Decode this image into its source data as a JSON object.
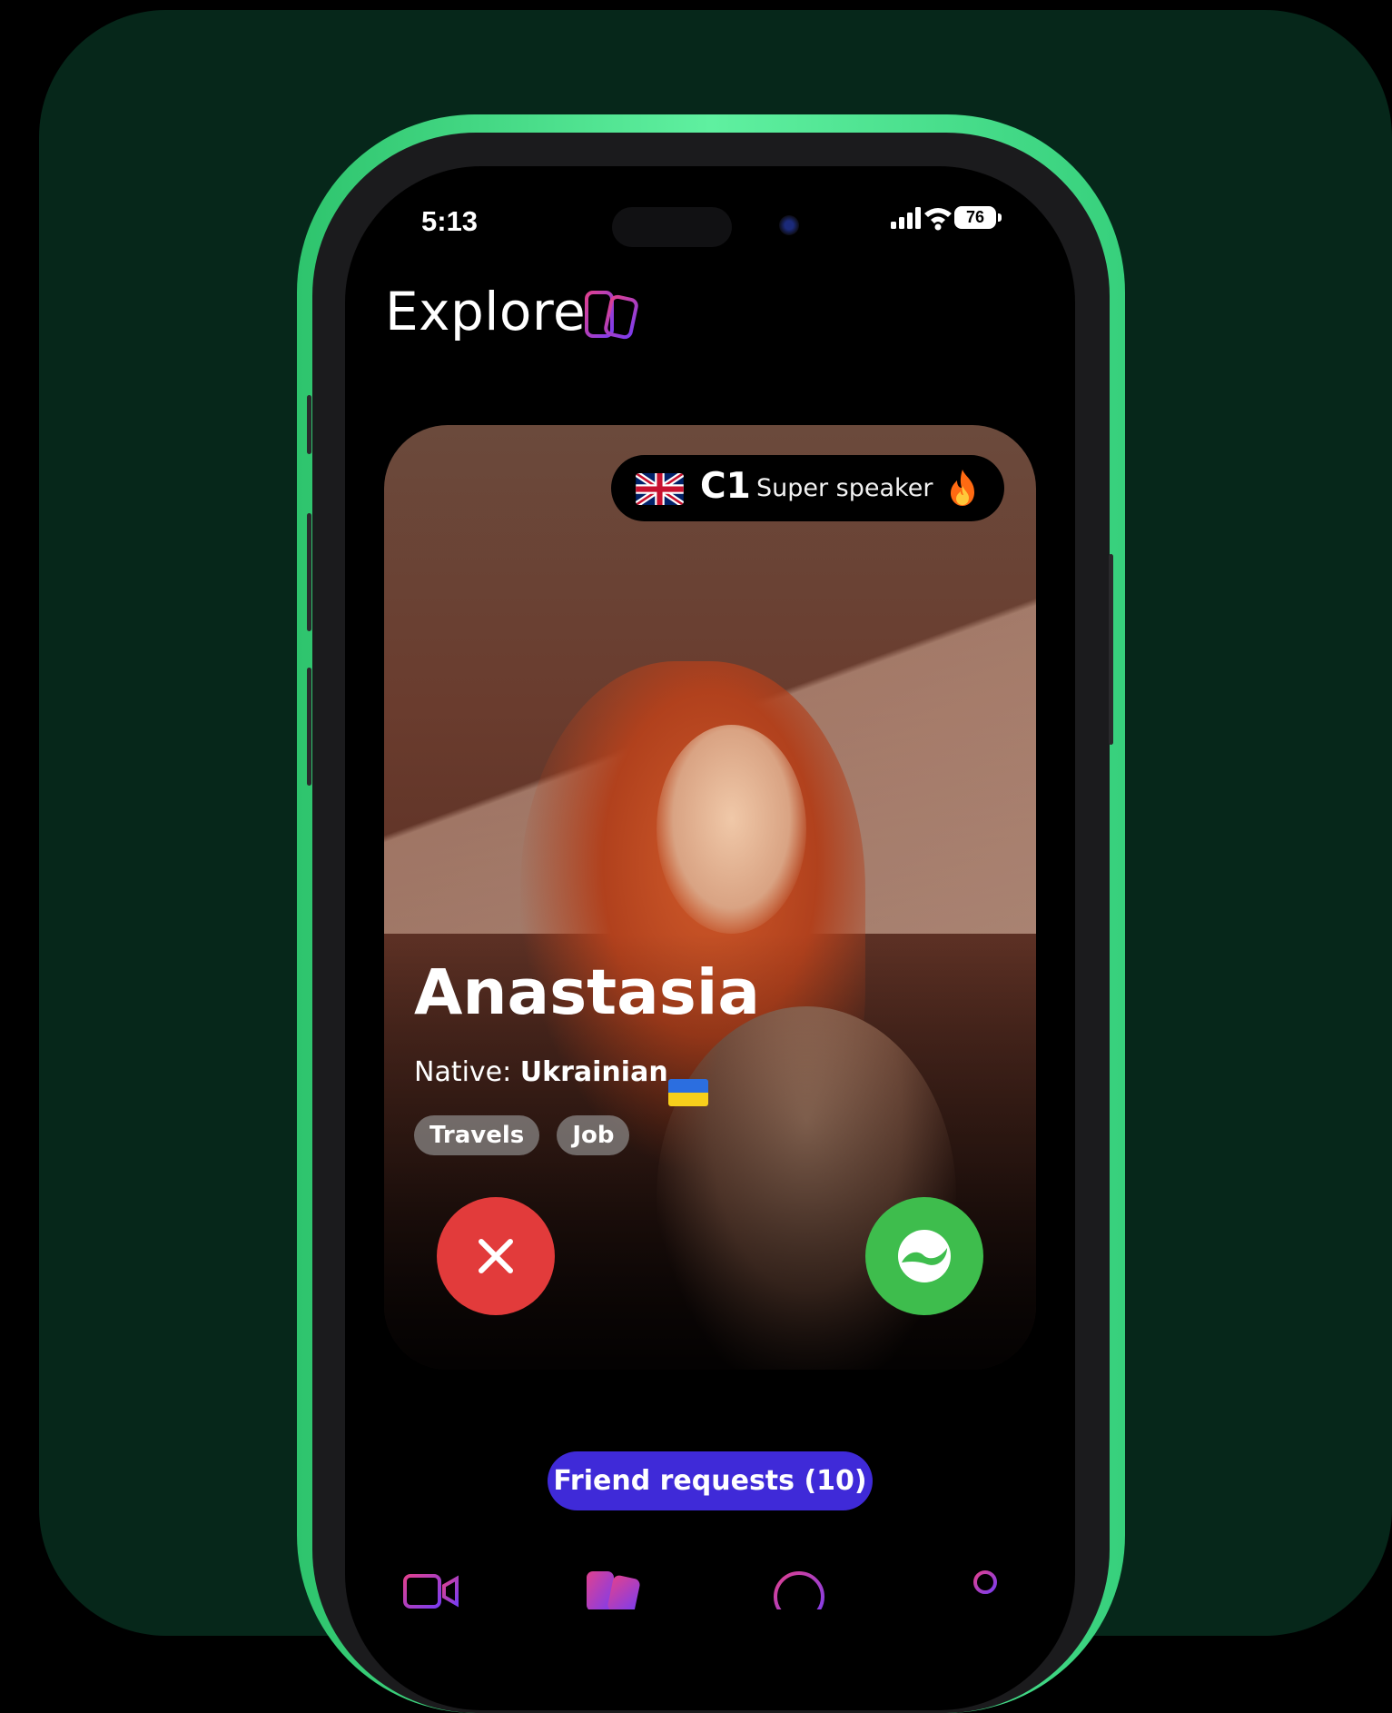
{
  "status_bar": {
    "time": "5:13",
    "battery": "76",
    "icons": [
      "signal-icon",
      "wifi-icon",
      "battery-icon"
    ]
  },
  "header": {
    "title": "Explore",
    "icon": "cards-icon"
  },
  "profile_card": {
    "level": {
      "flag": "uk-flag-icon",
      "code": "C1",
      "label": "Super speaker",
      "icon": "flame-icon"
    },
    "name": "Anastasia",
    "native_label": "Native:",
    "native_language": "Ukrainian",
    "native_flag": "ukraine-flag-icon",
    "tags": [
      "Travels",
      "Job"
    ],
    "actions": {
      "decline_icon": "close-icon",
      "accept_icon": "connect-icon"
    }
  },
  "friend_requests": {
    "label": "Friend requests (10)"
  },
  "colors": {
    "background": "#06271a",
    "phone_accent": "#4ee08a",
    "decline": "#e23b3b",
    "accept": "#3ebd4d",
    "friend_requests": "#3f2ad8",
    "brand_gradient": [
      "#e0418f",
      "#7a3cf0"
    ]
  },
  "tab_bar": {
    "items": [
      {
        "icon": "video-icon"
      },
      {
        "icon": "cards-icon",
        "active": true
      },
      {
        "icon": "chat-icon"
      },
      {
        "icon": "profile-icon"
      }
    ]
  }
}
